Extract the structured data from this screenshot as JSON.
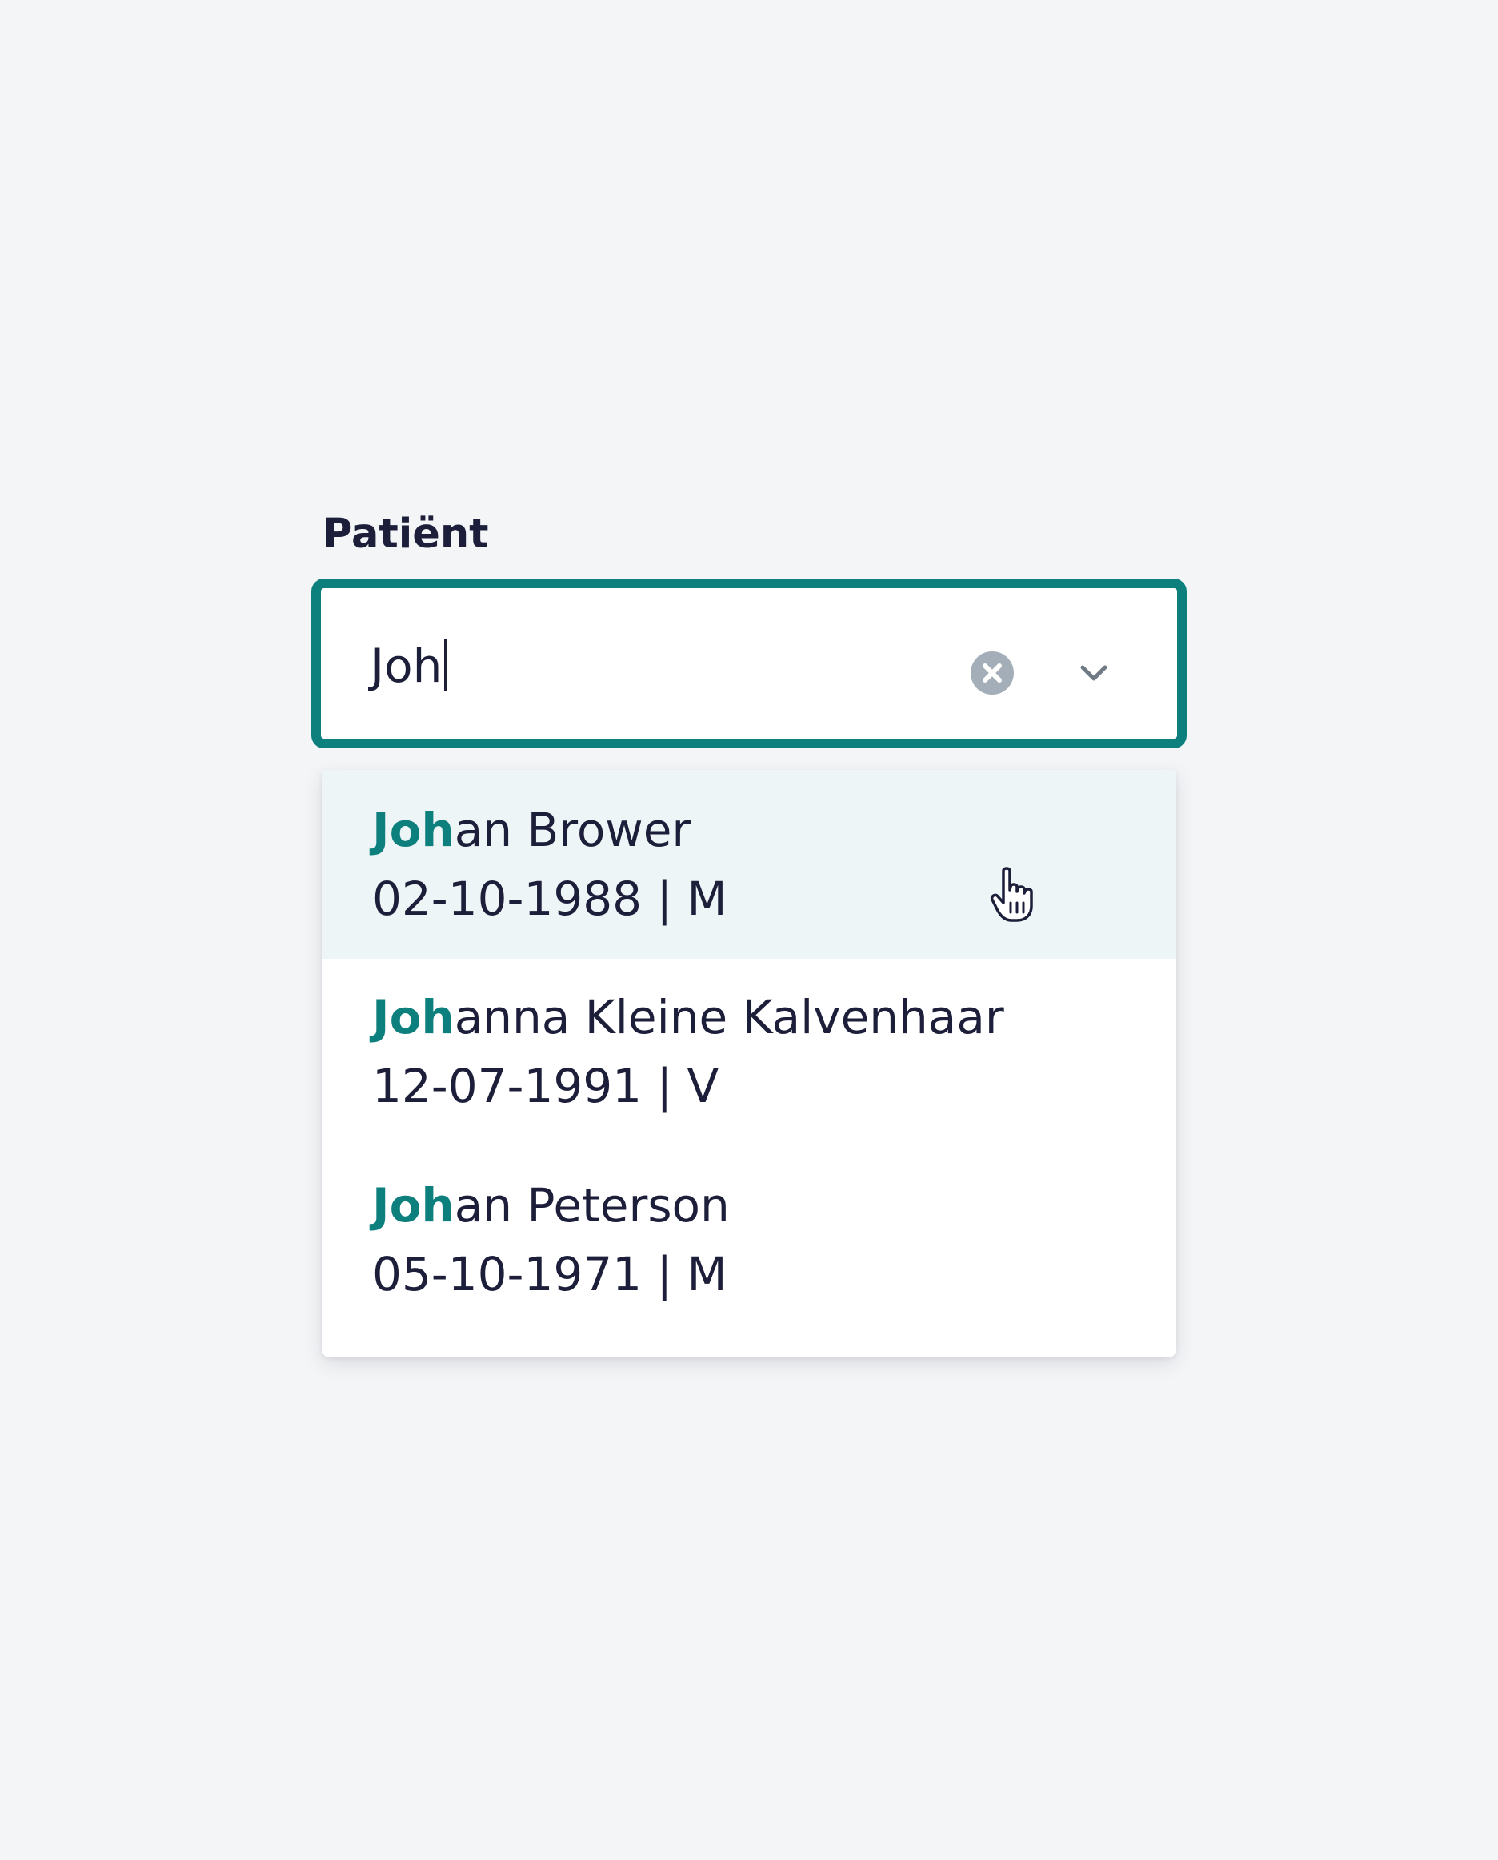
{
  "field": {
    "label": "Patiënt",
    "value": "Joh",
    "clear_icon": "close-circle-icon",
    "toggle_icon": "chevron-down-icon"
  },
  "colors": {
    "accent": "#0d7f7d",
    "highlight": "#edf5f6",
    "text": "#1c1e3a",
    "clear_icon": "#a3aeb8",
    "background": "#f4f5f7"
  },
  "options": [
    {
      "match": "Joh",
      "rest": "an Brower",
      "meta": "02-10-1988 | M",
      "highlighted": true
    },
    {
      "match": "Joh",
      "rest": "anna Kleine Kalvenhaar",
      "meta": "12-07-1991 | V",
      "highlighted": false
    },
    {
      "match": "Joh",
      "rest": "an Peterson",
      "meta": "05-10-1971 | M",
      "highlighted": false
    }
  ]
}
